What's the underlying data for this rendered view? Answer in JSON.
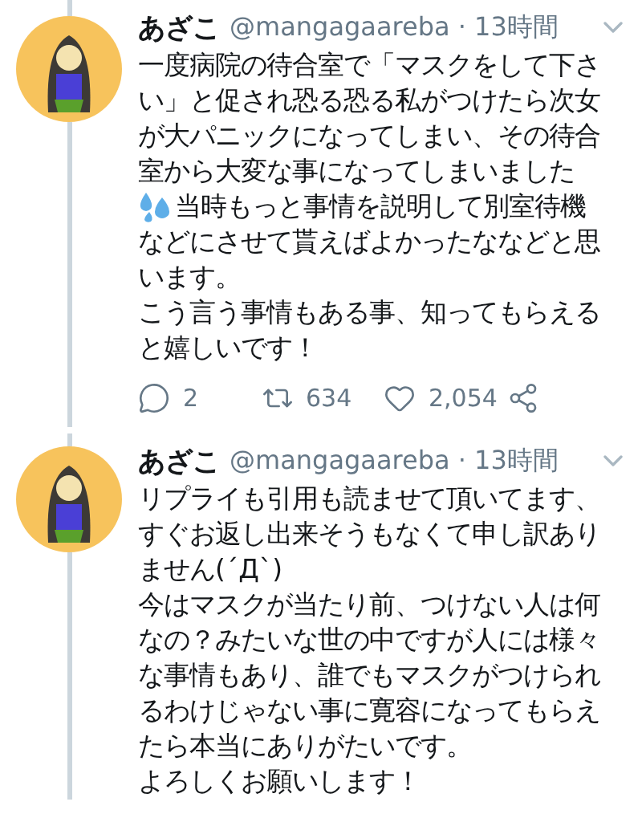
{
  "tweets": [
    {
      "name": "あざこ",
      "meta": "@mangagaareba · 13時間",
      "lines": [
        {
          "text": "一度病院の待合室で「マスクをして下さ"
        },
        {
          "text": "い」と促され恐る恐る私がつけたら次女"
        },
        {
          "text": "が大パニックになってしまい、その待合"
        },
        {
          "text": "室から大変な事になってしまいました"
        },
        {
          "text": "当時もっと事情を説明して別室待機",
          "emoji": true
        },
        {
          "text": "などにさせて貰えばよかったななどと思"
        },
        {
          "text": "います。"
        },
        {
          "text": "こう言う事情もある事、知ってもらえる"
        },
        {
          "text": "と嬉しいです！"
        }
      ],
      "actions": [
        {
          "kind": "reply",
          "count": "2"
        },
        {
          "kind": "retweet",
          "count": "634"
        },
        {
          "kind": "like",
          "count": "2,054"
        },
        {
          "kind": "share"
        }
      ]
    },
    {
      "name": "あざこ",
      "meta": "@mangagaareba · 13時間",
      "lines": [
        {
          "text": "リプライも引用も読ませて頂いてます、"
        },
        {
          "text": "すぐお返し出来そうもなくて申し訳あり"
        },
        {
          "text": "ません(´Д`)"
        },
        {
          "text": "今はマスクが当たり前、つけない人は何"
        },
        {
          "text": "なの？みたいな世の中ですが人には様々"
        },
        {
          "text": "な事情もあり、誰でもマスクがつけられ"
        },
        {
          "text": "るわけじゃない事に寛容になってもらえ"
        },
        {
          "text": "たら本当にありがたいです。"
        },
        {
          "text": "よろしくお願いします！"
        }
      ]
    }
  ]
}
